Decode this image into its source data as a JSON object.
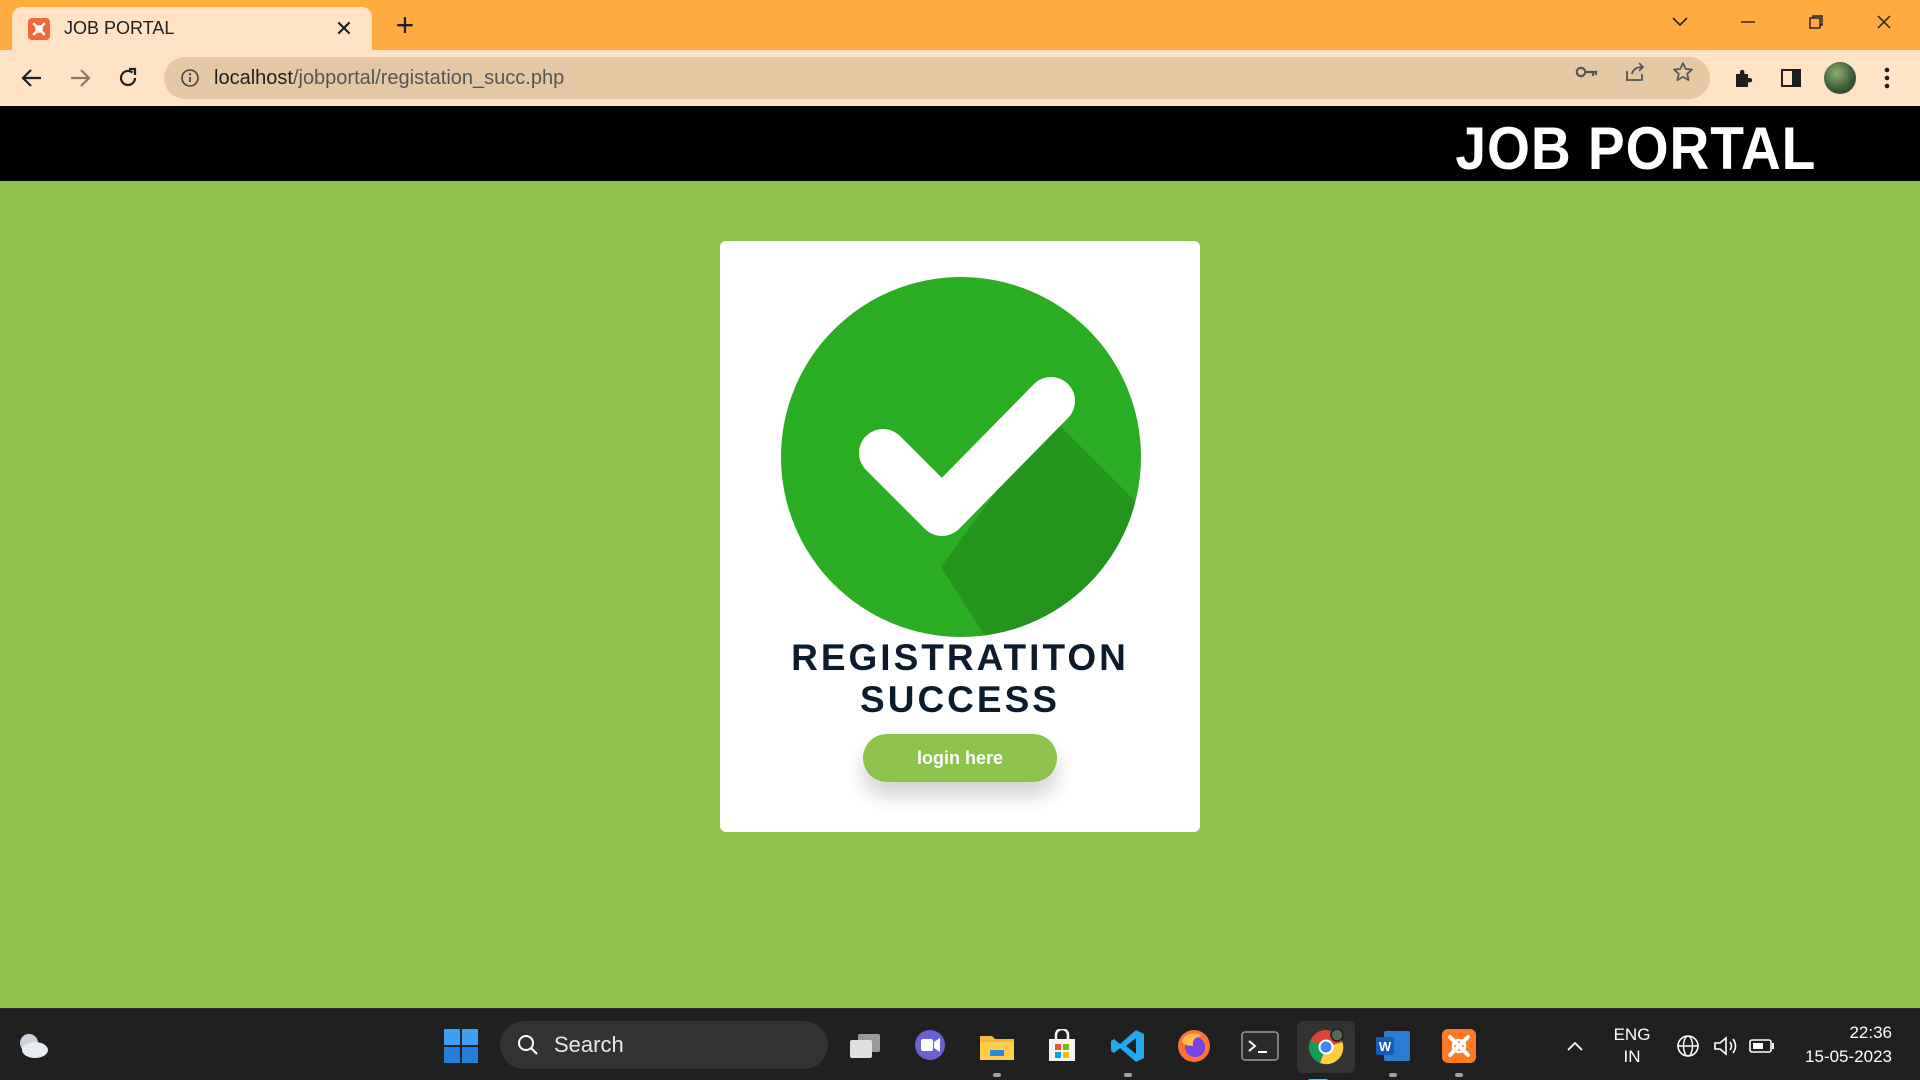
{
  "browser": {
    "tab_title": "JOB PORTAL",
    "url_host": "localhost",
    "url_path": "/jobportal/registation_succ.php"
  },
  "site": {
    "brand": "JOB PORTAL"
  },
  "card": {
    "message_line1": "REGISTRATITON",
    "message_line2": "SUCCESS",
    "login_label": "login here"
  },
  "taskbar": {
    "search_label": "Search",
    "lang_line1": "ENG",
    "lang_line2": "IN",
    "time": "22:36",
    "date": "15-05-2023"
  },
  "colors": {
    "tabstrip": "#ffab40",
    "page_bg": "#8dc24b",
    "check_green": "#2aad22"
  }
}
